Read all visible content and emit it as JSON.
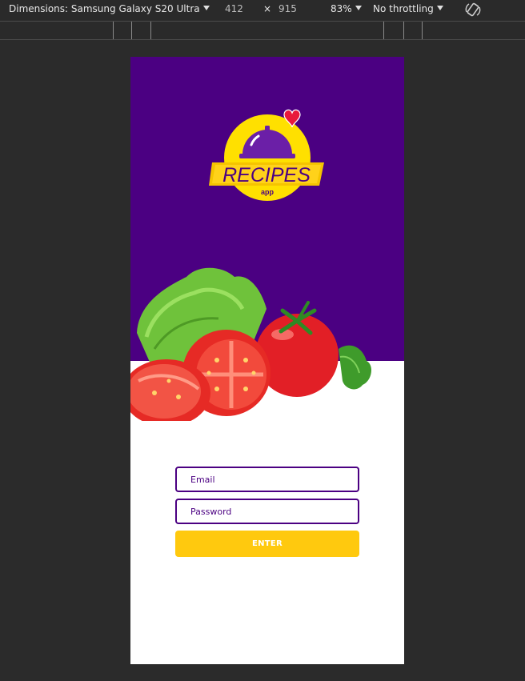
{
  "devtools": {
    "dimensions_label": "Dimensions: Samsung Galaxy S20 Ultra",
    "width_value": "412",
    "times": "×",
    "height_value": "915",
    "zoom": "83%",
    "throttling": "No throttling"
  },
  "app": {
    "logo_title": "RECIPES",
    "logo_subtitle": "app",
    "email_placeholder": "Email",
    "password_placeholder": "Password",
    "enter_label": "ENTER"
  },
  "colors": {
    "brand_purple": "#4b0082",
    "accent_yellow": "#ffc90e",
    "heart_red": "#e8193c"
  }
}
